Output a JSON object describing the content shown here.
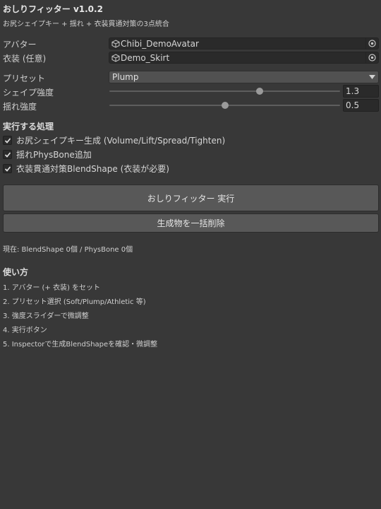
{
  "header": {
    "title": "おしりフィッター v1.0.2",
    "subtitle": "お尻シェイプキー + 揺れ + 衣装貫通対策の3点統合"
  },
  "fields": {
    "avatar_label": "アバター",
    "avatar_value": "Chibi_DemoAvatar",
    "costume_label": "衣装 (任意)",
    "costume_value": "Demo_Skirt",
    "preset_label": "プリセット",
    "preset_value": "Plump",
    "shape_label": "シェイプ強度",
    "shape_value": "1.3",
    "shape_fraction": 0.65,
    "sway_label": "揺れ強度",
    "sway_value": "0.5",
    "sway_fraction": 0.5
  },
  "process": {
    "heading": "実行する処理",
    "items": [
      {
        "label": "お尻シェイプキー生成 (Volume/Lift/Spread/Tighten)",
        "checked": true
      },
      {
        "label": "揺れPhysBone追加",
        "checked": true
      },
      {
        "label": "衣装貫通対策BlendShape (衣装が必要)",
        "checked": true
      }
    ]
  },
  "buttons": {
    "run": "おしりフィッター 実行",
    "delete_all": "生成物を一括削除"
  },
  "status": {
    "text": "現在: BlendShape 0個 / PhysBone 0個"
  },
  "usage": {
    "heading": "使い方",
    "steps": [
      "1. アバター (+ 衣装) をセット",
      "2. プリセット選択 (Soft/Plump/Athletic 等)",
      "3. 強度スライダーで微調整",
      "4. 実行ボタン",
      "5. Inspectorで生成BlendShapeを確認・微調整"
    ]
  },
  "colors": {
    "background": "#383838",
    "field": "#2a2a2a",
    "button": "#585858",
    "text": "#d2d2d2"
  },
  "icons": {
    "object_field": "cube-icon",
    "picker": "object-picker-icon",
    "dropdown": "triangle-down-icon",
    "checkbox": "checkmark-icon"
  }
}
